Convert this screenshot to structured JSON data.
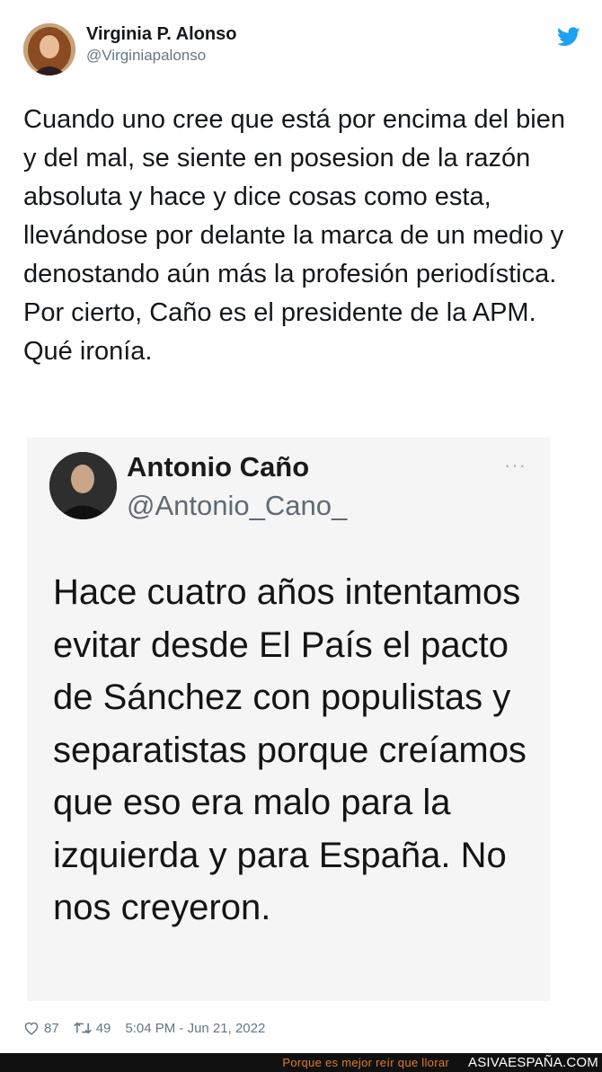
{
  "author": {
    "name": "Virginia P. Alonso",
    "handle": "@Virginiapalonso"
  },
  "tweet": {
    "text": "Cuando uno cree que está por encima del bien y del mal, se siente en posesion de la razón absoluta y hace y dice cosas como esta, llevándose por delante la marca de un medio y denostando aún más la profesión periodística. Por cierto, Caño es el presidente de la APM. Qué ironía."
  },
  "embed": {
    "name": "Antonio Caño",
    "handle": "@Antonio_Cano_",
    "more": "···",
    "text": "Hace cuatro años intentamos evitar desde El País el pacto de Sánchez con populistas y separatistas porque creíamos que eso era malo para la izquierda y para España. No nos creyeron."
  },
  "meta": {
    "likes": "87",
    "retweets": "49",
    "timestamp": "5:04 PM - Jun 21, 2022"
  },
  "footer": {
    "tagline": "Porque es mejor reír que llorar",
    "site": "ASIVAESPAÑA.COM"
  },
  "icons": {
    "brand": "twitter-bird-icon",
    "like": "heart-icon",
    "retweet": "retweet-icon"
  },
  "colors": {
    "twitter_blue": "#1da1f2",
    "secondary_text": "#657786",
    "footer_bg": "#111111",
    "footer_accent": "#e07b2a"
  }
}
